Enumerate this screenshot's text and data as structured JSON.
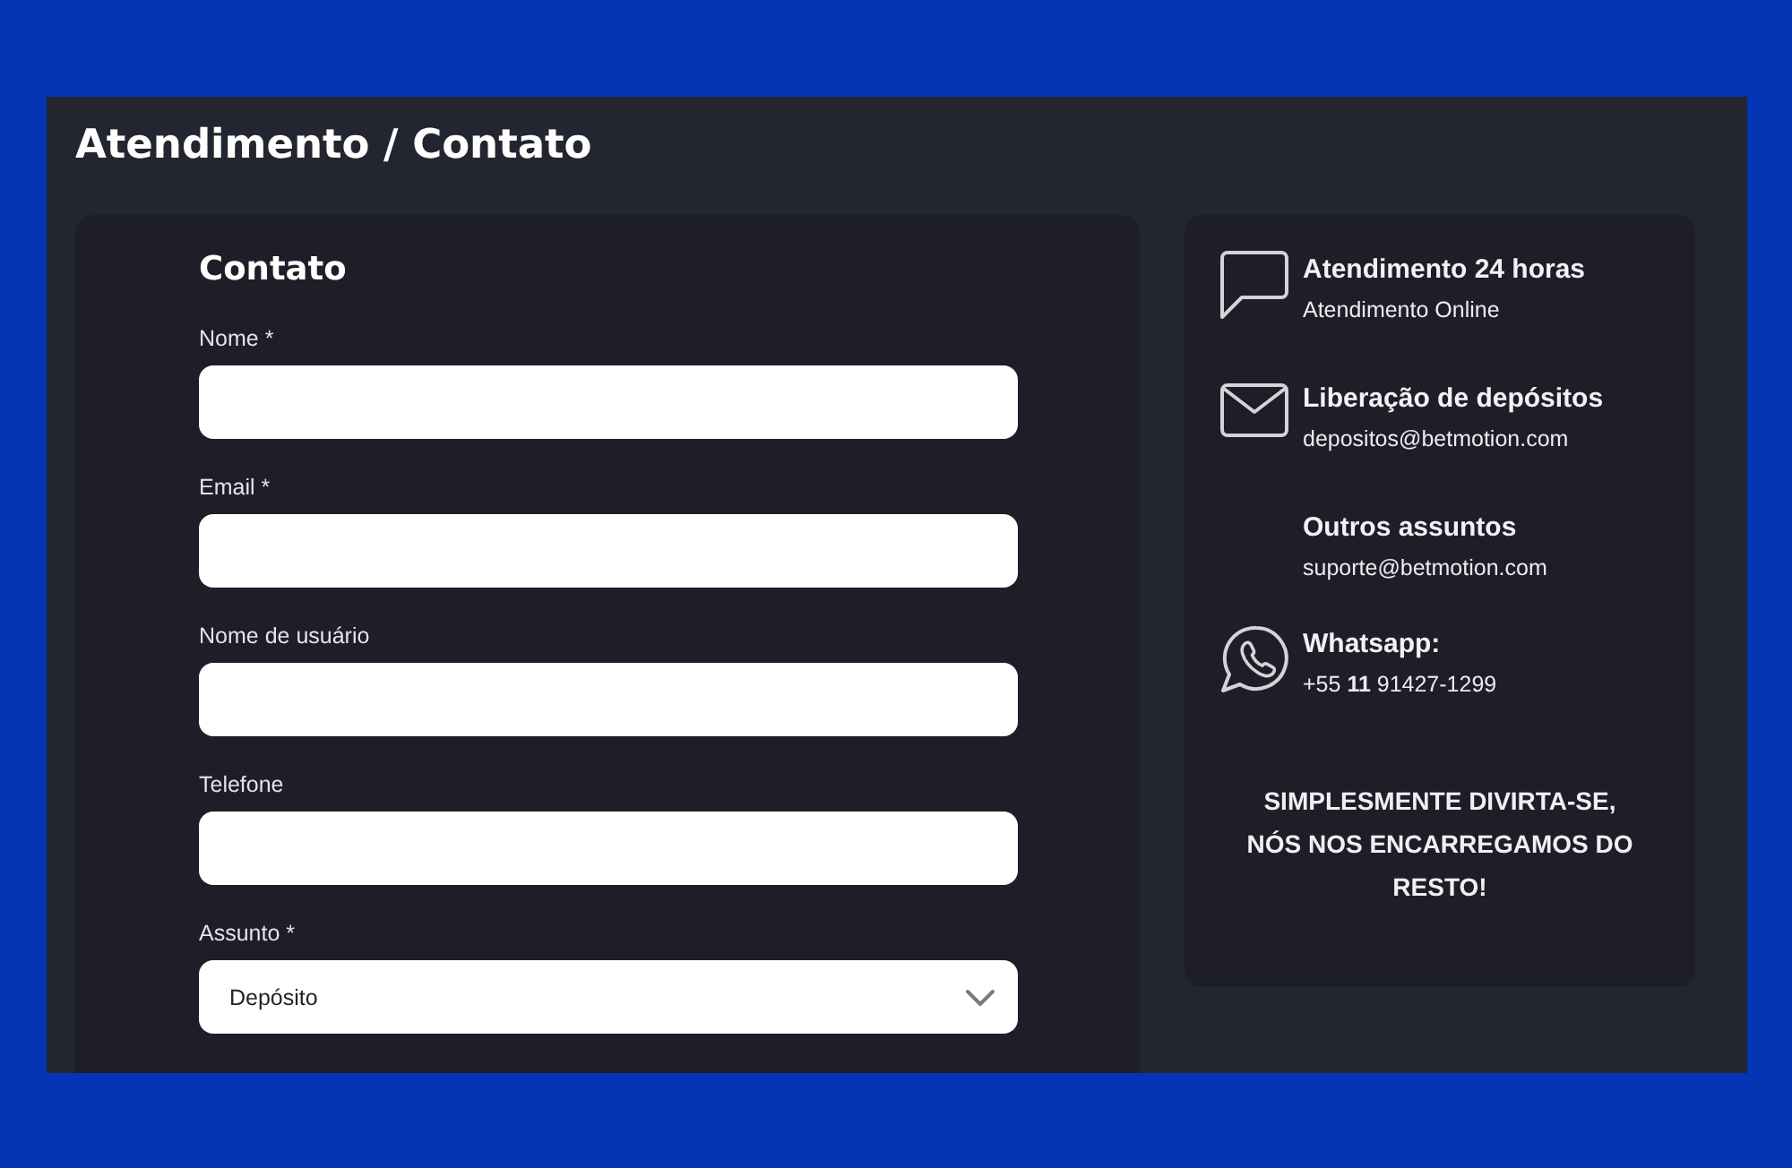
{
  "page": {
    "title": "Atendimento / Contato"
  },
  "form": {
    "heading": "Contato",
    "fields": [
      {
        "kind": "text",
        "label": "Nome *"
      },
      {
        "kind": "text",
        "label": "Email *"
      },
      {
        "kind": "text",
        "label": "Nome de usuário"
      },
      {
        "kind": "text",
        "label": "Telefone"
      },
      {
        "kind": "select",
        "label": "Assunto *",
        "value": "Depósito"
      }
    ]
  },
  "contacts": {
    "items": [
      {
        "kind": "chat",
        "title": "Atendimento 24 horas",
        "detail": "Atendimento Online"
      },
      {
        "kind": "mail",
        "title": "Liberação de depósitos",
        "detail": "depositos@betmotion.com"
      },
      {
        "kind": "plain",
        "title": "Outros assuntos",
        "detail": "suporte@betmotion.com"
      },
      {
        "kind": "whatsapp",
        "title": "Whatsapp:",
        "detail": "+55 **11** 91427-1299"
      }
    ],
    "slogan": "SIMPLESMENTE DIVIRTA-SE, NÓS NOS ENCARREGAMOS DO RESTO!"
  }
}
